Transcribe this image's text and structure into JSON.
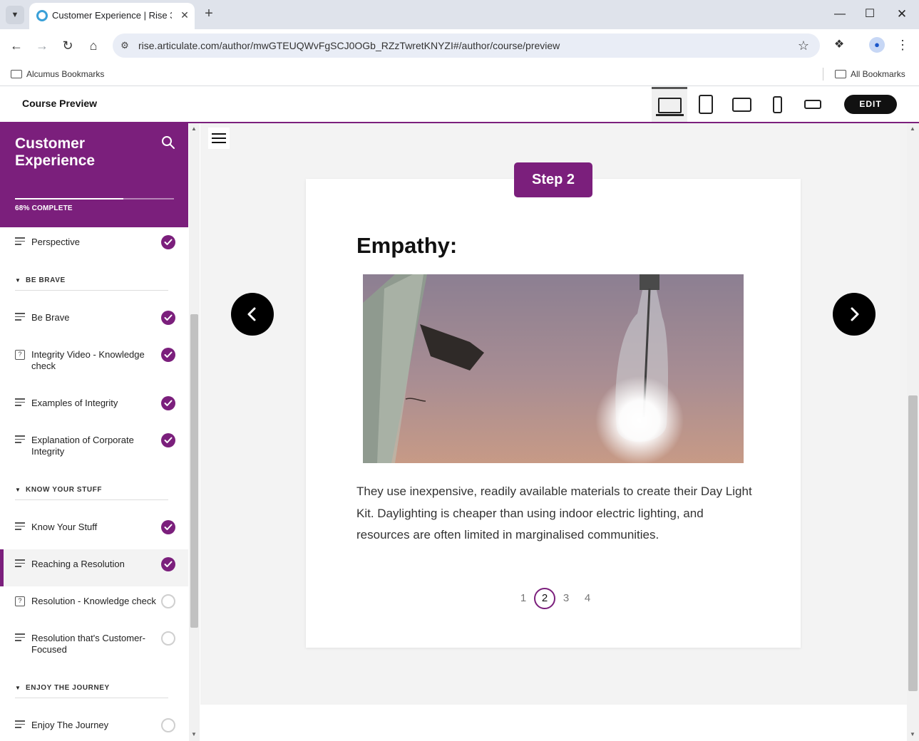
{
  "browser": {
    "tab_title": "Customer Experience | Rise 360",
    "url": "rise.articulate.com/author/mwGTEUQWvFgSCJ0OGb_RZzTwretKNYZI#/author/course/preview",
    "bookmarks_folder": "Alcumus Bookmarks",
    "all_bookmarks": "All Bookmarks"
  },
  "header": {
    "title": "Course Preview",
    "edit_label": "EDIT",
    "devices": [
      "desktop",
      "tablet-portrait",
      "tablet-landscape",
      "phone-portrait",
      "phone-landscape"
    ],
    "active_device": "desktop"
  },
  "sidebar": {
    "course_title": "Customer Experience",
    "progress_percent": 68,
    "progress_label": "68% COMPLETE",
    "outline": [
      {
        "kind": "lesson",
        "icon": "lines-icon",
        "label": "Perspective",
        "done": true
      },
      {
        "kind": "section",
        "label": "BE BRAVE"
      },
      {
        "kind": "lesson",
        "icon": "lines-icon",
        "label": "Be Brave",
        "done": true
      },
      {
        "kind": "lesson",
        "icon": "quiz-icon",
        "label": "Integrity Video - Knowledge check",
        "done": true
      },
      {
        "kind": "lesson",
        "icon": "lines-icon",
        "label": "Examples of Integrity",
        "done": true
      },
      {
        "kind": "lesson",
        "icon": "lines-icon",
        "label": "Explanation of Corporate Integrity",
        "done": true
      },
      {
        "kind": "section",
        "label": "KNOW YOUR STUFF"
      },
      {
        "kind": "lesson",
        "icon": "lines-icon",
        "label": "Know Your Stuff",
        "done": true
      },
      {
        "kind": "lesson",
        "icon": "lines-icon",
        "label": "Reaching a Resolution",
        "done": true,
        "active": true
      },
      {
        "kind": "lesson",
        "icon": "quiz-icon",
        "label": "Resolution - Knowledge check",
        "done": false
      },
      {
        "kind": "lesson",
        "icon": "lines-icon",
        "label": "Resolution that's Customer-Focused",
        "done": false
      },
      {
        "kind": "section",
        "label": "ENJOY THE JOURNEY"
      },
      {
        "kind": "lesson",
        "icon": "lines-icon",
        "label": "Enjoy The Journey",
        "done": false
      }
    ]
  },
  "slide": {
    "step_label": "Step 2",
    "heading": "Empathy:",
    "image_icon": "bottle-light-photo",
    "body": "They use inexpensive, readily available materials to create their Day Light Kit. Daylighting is cheaper than using indoor electric lighting, and resources are often limited in marginalised communities.",
    "pages": [
      "1",
      "2",
      "3",
      "4"
    ],
    "current_page": "2"
  },
  "colors": {
    "accent": "#7b1f7c",
    "button_dark": "#111111",
    "main_bg": "#f3f3f3"
  }
}
